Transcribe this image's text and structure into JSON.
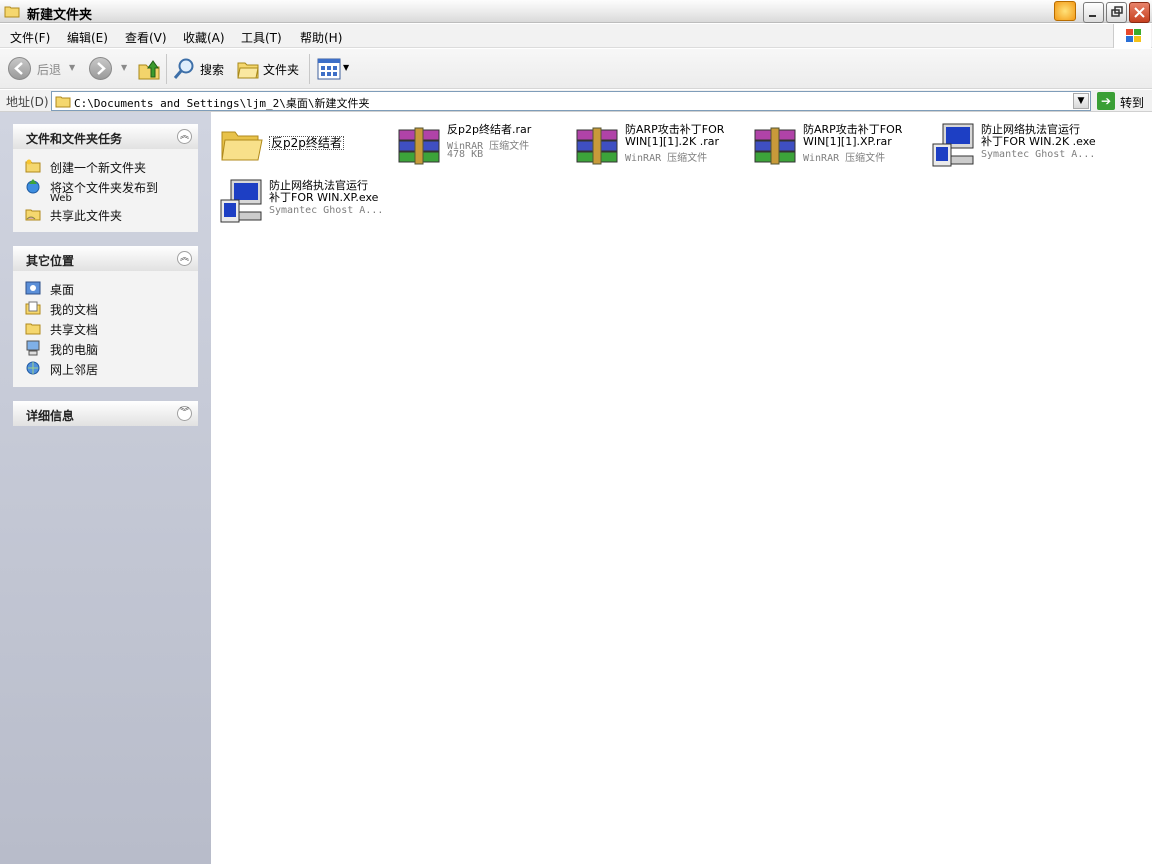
{
  "window": {
    "title": "新建文件夹",
    "title_icon": "folder-icon"
  },
  "menu": [
    "文件(F)",
    "编辑(E)",
    "查看(V)",
    "收藏(A)",
    "工具(T)",
    "帮助(H)"
  ],
  "toolbar": {
    "back_label": "后退",
    "search_label": "搜索",
    "folders_label": "文件夹"
  },
  "address": {
    "label": "地址(D)",
    "value": "C:\\Documents and Settings\\ljm_2\\桌面\\新建文件夹",
    "go_label": "转到"
  },
  "sidebar": {
    "tasks": {
      "title": "文件和文件夹任务",
      "items": [
        {
          "label": "创建一个新文件夹",
          "icon": "new-folder-icon"
        },
        {
          "label": "将这个文件夹发布到",
          "sub": "Web",
          "icon": "publish-web-icon"
        },
        {
          "label": "共享此文件夹",
          "icon": "share-folder-icon"
        }
      ]
    },
    "places": {
      "title": "其它位置",
      "items": [
        {
          "label": "桌面",
          "icon": "desktop-icon"
        },
        {
          "label": "我的文档",
          "icon": "my-documents-icon"
        },
        {
          "label": "共享文档",
          "icon": "shared-documents-icon"
        },
        {
          "label": "我的电脑",
          "icon": "my-computer-icon"
        },
        {
          "label": "网上邻居",
          "icon": "network-places-icon"
        }
      ]
    },
    "details": {
      "title": "详细信息"
    }
  },
  "files": [
    {
      "name": "反p2p终结者",
      "type": "folder",
      "icon": "folder-icon"
    },
    {
      "name": "反p2p终结者.rar",
      "meta1": "WinRAR 压缩文件",
      "meta2": "478 KB",
      "icon": "winrar-archive-icon"
    },
    {
      "name1": "防ARP攻击补丁FOR",
      "name2": "WIN[1][1].2K .rar",
      "meta1": "WinRAR 压缩文件",
      "icon": "winrar-archive-icon"
    },
    {
      "name1": "防ARP攻击补丁FOR",
      "name2": "WIN[1][1].XP.rar",
      "meta1": "WinRAR 压缩文件",
      "icon": "winrar-archive-icon"
    },
    {
      "name1": "防止网络执法官运行",
      "name2": "补丁FOR WIN.2K .exe",
      "meta1": "Symantec Ghost A...",
      "icon": "installer-icon"
    },
    {
      "name1": "防止网络执法官运行",
      "name2": "补丁FOR WIN.XP.exe",
      "meta1": "Symantec Ghost A...",
      "icon": "installer-icon"
    }
  ]
}
